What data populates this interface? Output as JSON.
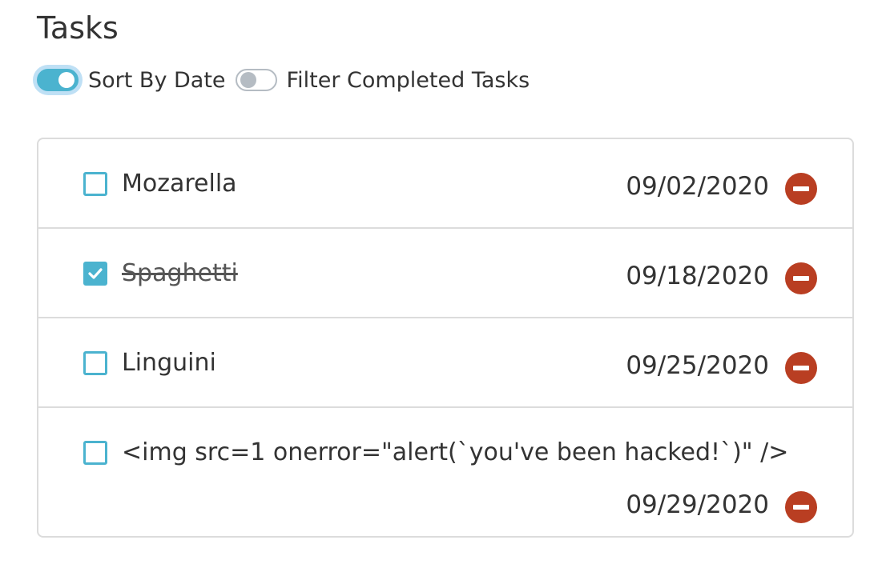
{
  "header": {
    "title": "Tasks"
  },
  "controls": {
    "sort_by_date": {
      "label": "Sort By Date",
      "on": true
    },
    "filter_completed": {
      "label": "Filter Completed Tasks",
      "on": false
    }
  },
  "tasks": [
    {
      "name": "Mozarella",
      "date": "09/02/2020",
      "completed": false
    },
    {
      "name": "Spaghetti",
      "date": "09/18/2020",
      "completed": true
    },
    {
      "name": "Linguini",
      "date": "09/25/2020",
      "completed": false
    },
    {
      "name": "<img src=1 onerror=\"alert(`you've been hacked!`)\" />",
      "date": "09/29/2020",
      "completed": false
    }
  ],
  "colors": {
    "accent": "#4bb3cf",
    "delete": "#b93e22",
    "border": "#dcdcdc",
    "text": "#333333"
  },
  "icons": {
    "checkbox_checked": "checkmark-icon",
    "delete": "minus-circle-icon"
  }
}
